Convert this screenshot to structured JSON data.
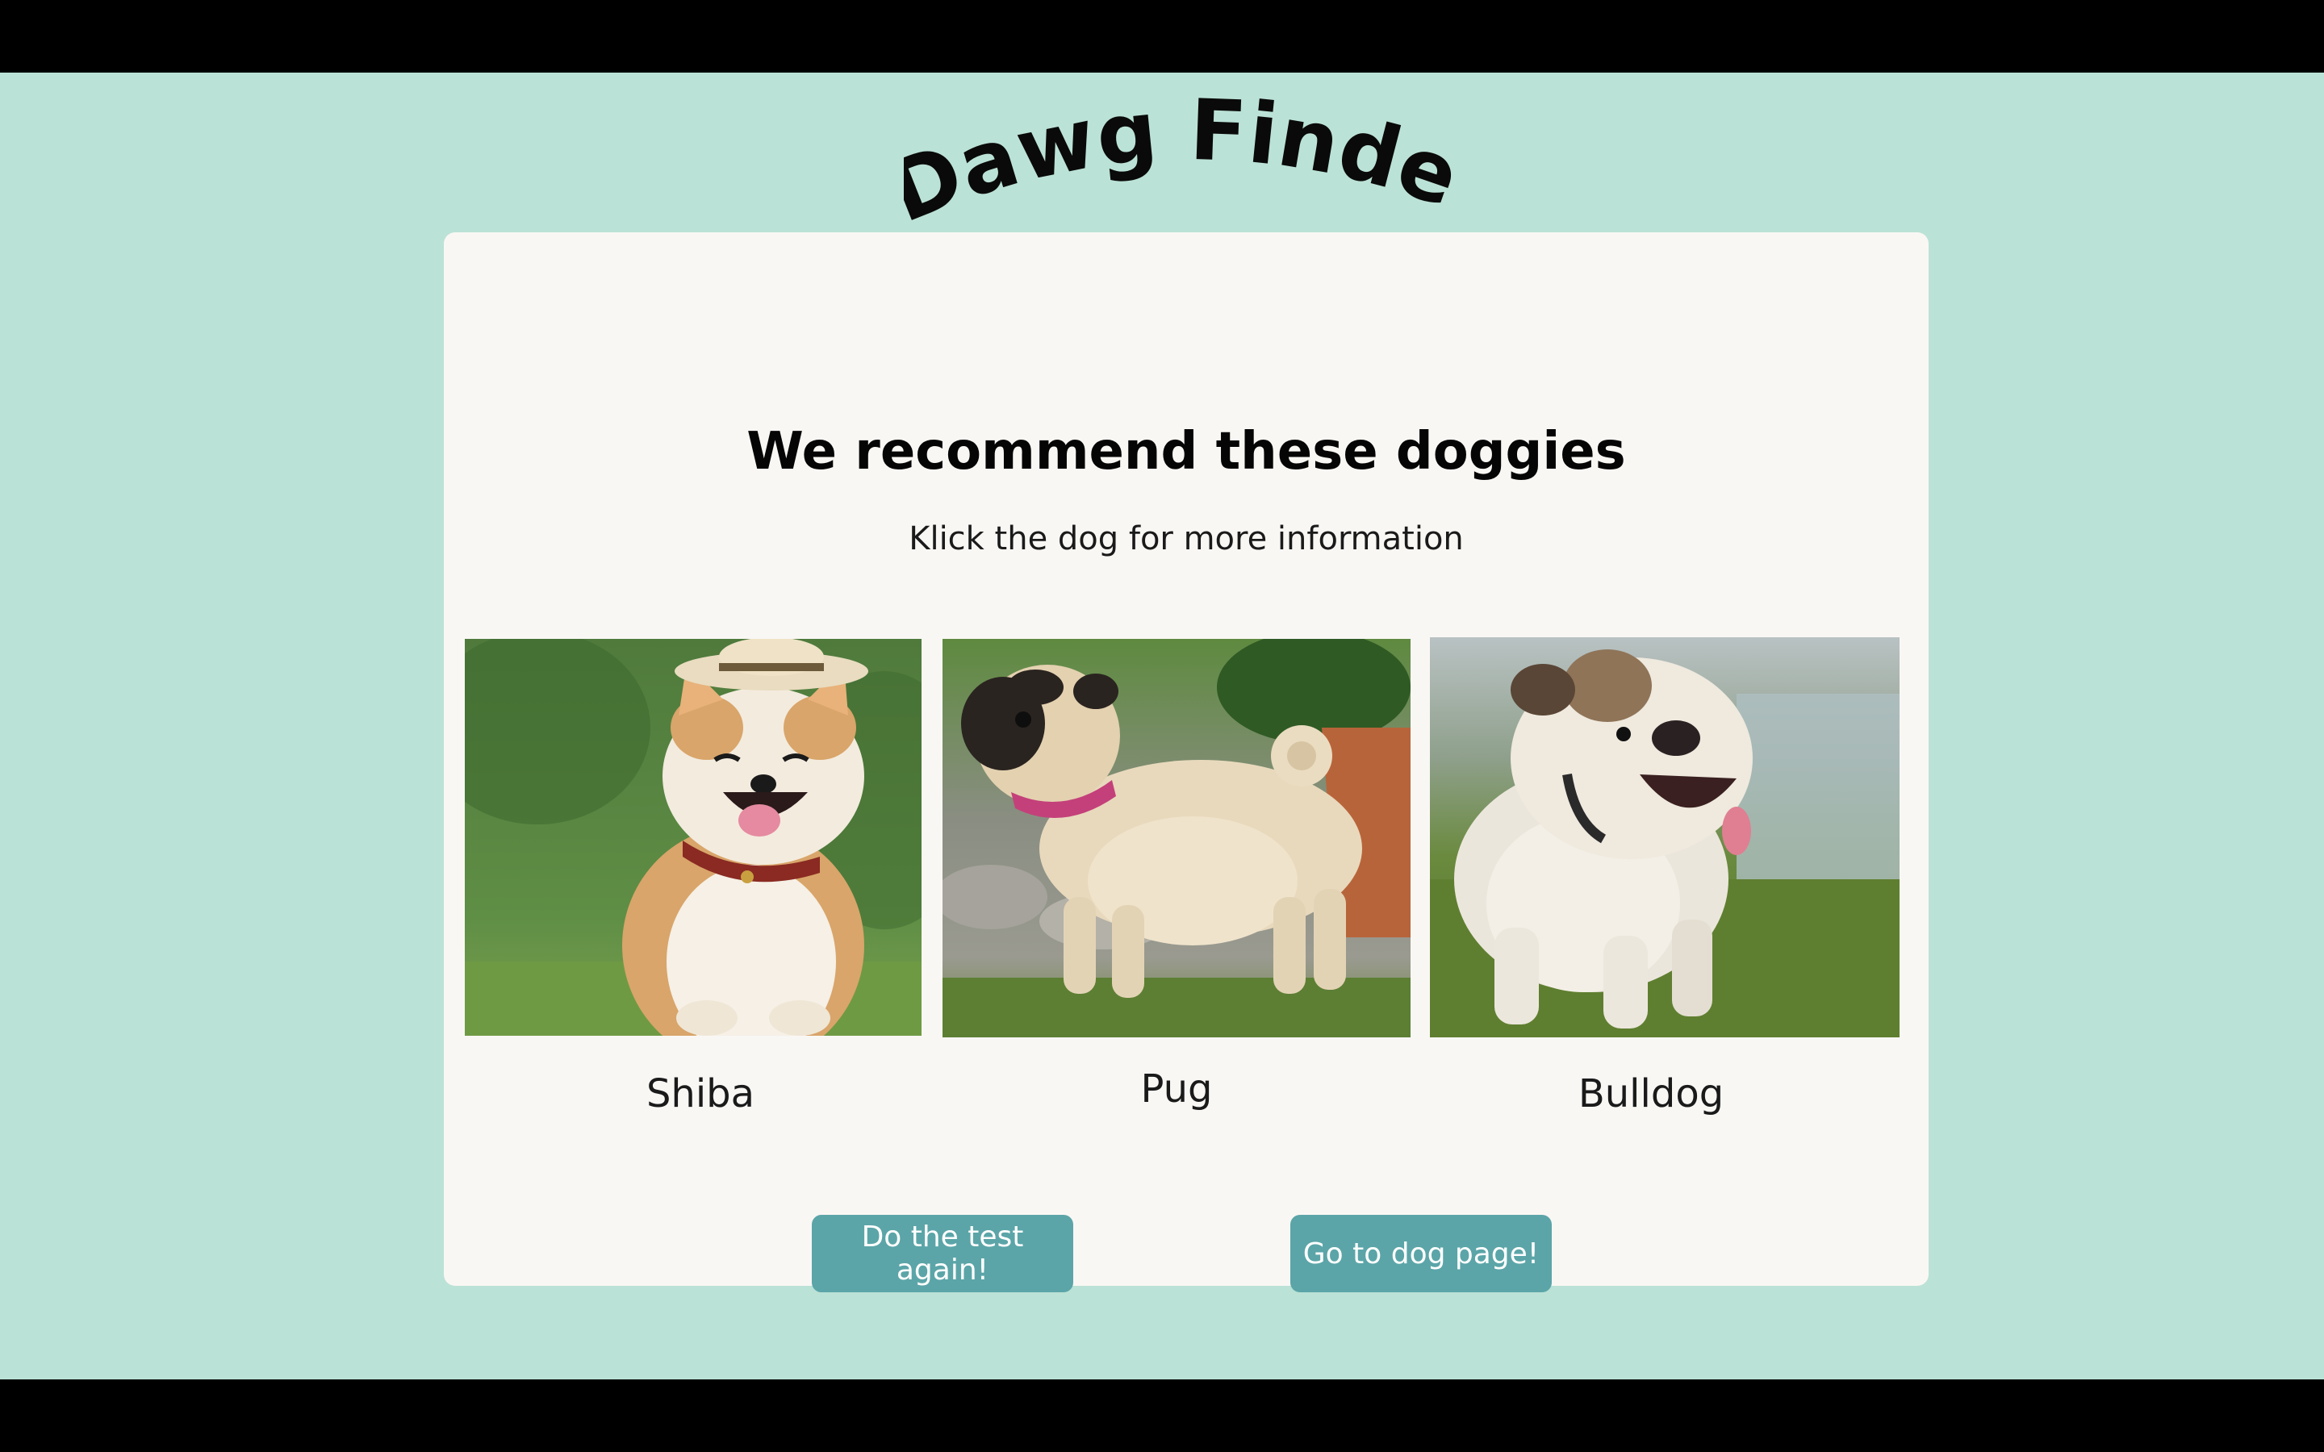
{
  "header": {
    "logo_text": "Dawg Finder"
  },
  "main": {
    "title": "We recommend these doggies",
    "subtitle": "Klick the dog for more information",
    "dogs": [
      {
        "name": "Shiba"
      },
      {
        "name": "Pug"
      },
      {
        "name": "Bulldog"
      }
    ],
    "buttons": {
      "retry_label": "Do the test again!",
      "dog_page_label": "Go to dog page!"
    }
  },
  "colors": {
    "page_background": "#bbe2d6",
    "card_background": "#f9f7f4",
    "button_background": "#5ba5a8",
    "button_text": "#ffffff"
  }
}
